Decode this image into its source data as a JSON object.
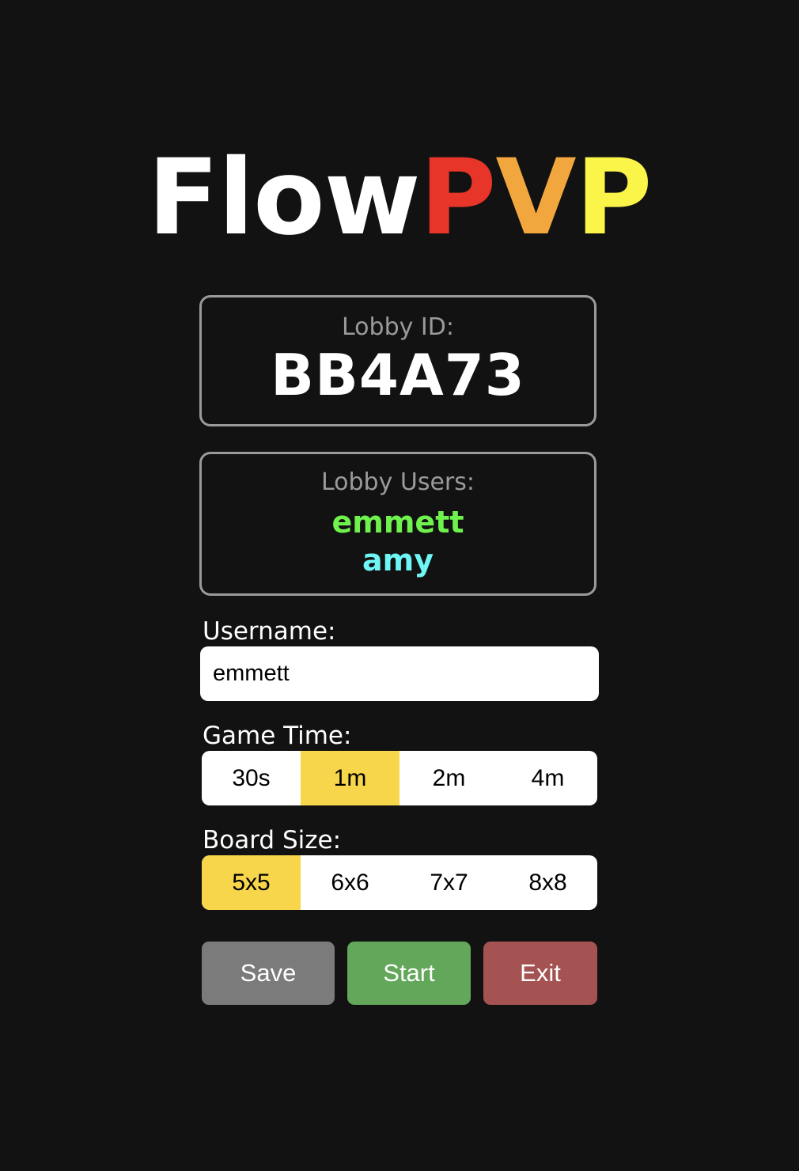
{
  "title": {
    "part1": "Flow",
    "part2_p": "P",
    "part2_v": "V",
    "part2_p2": "P"
  },
  "colors": {
    "background": "#121212",
    "title_p1": "#e8352a",
    "title_v": "#f1a73d",
    "title_p2": "#fbf54a",
    "selected": "#f8d64b",
    "save": "#7b7b7b",
    "start": "#62a75a",
    "exit": "#a45252"
  },
  "lobby": {
    "id_label": "Lobby ID:",
    "id_value": "BB4A73",
    "users_label": "Lobby Users:",
    "users": [
      {
        "name": "emmett",
        "color": "#6ff24d"
      },
      {
        "name": "amy",
        "color": "#6ef5f5"
      }
    ]
  },
  "username": {
    "label": "Username:",
    "value": "emmett"
  },
  "game_time": {
    "label": "Game Time:",
    "options": [
      "30s",
      "1m",
      "2m",
      "4m"
    ],
    "selected": "1m"
  },
  "board_size": {
    "label": "Board Size:",
    "options": [
      "5x5",
      "6x6",
      "7x7",
      "8x8"
    ],
    "selected": "5x5"
  },
  "buttons": {
    "save": "Save",
    "start": "Start",
    "exit": "Exit"
  }
}
